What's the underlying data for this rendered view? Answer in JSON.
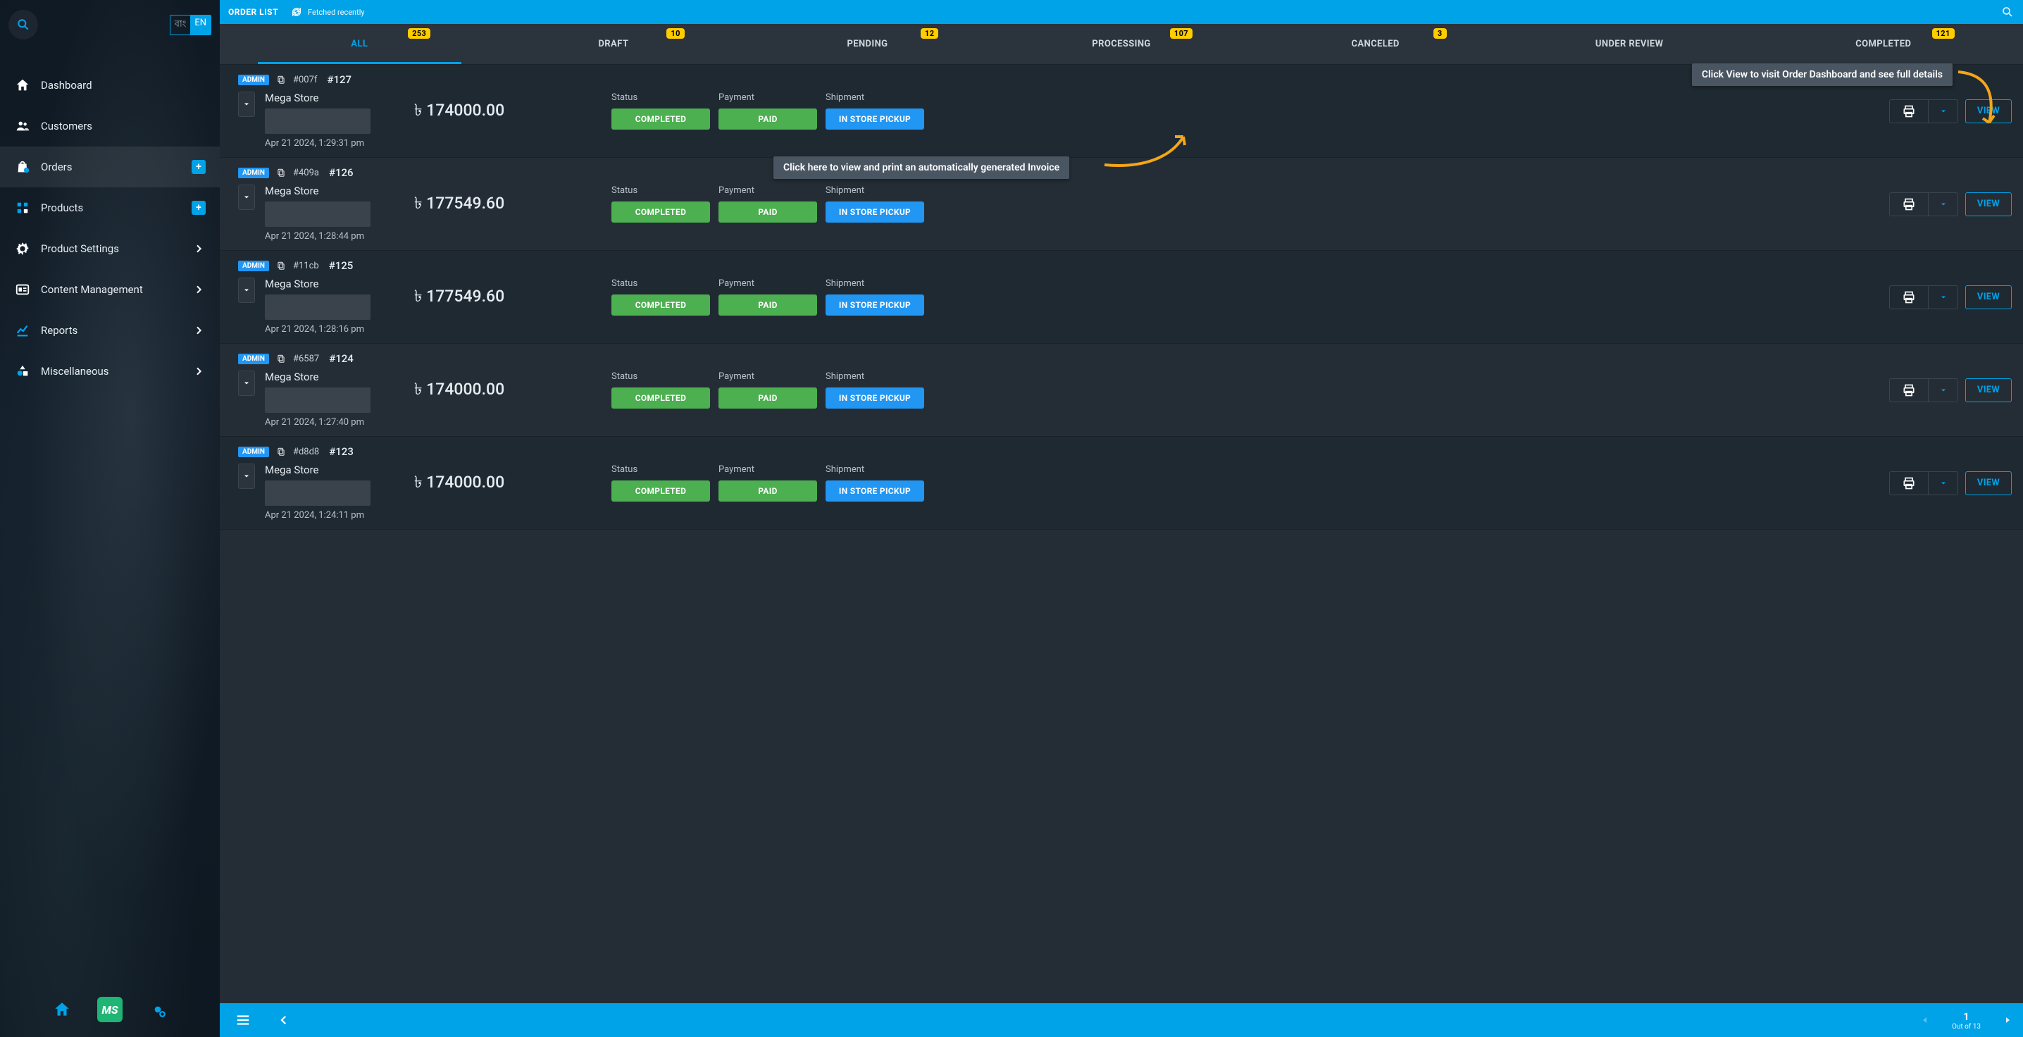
{
  "header": {
    "title": "ORDER LIST",
    "fetched": "Fetched recently"
  },
  "lang": {
    "inactive": "বাং",
    "active": "EN"
  },
  "sidebar": {
    "items": [
      {
        "label": "Dashboard"
      },
      {
        "label": "Customers"
      },
      {
        "label": "Orders"
      },
      {
        "label": "Products"
      },
      {
        "label": "Product Settings"
      },
      {
        "label": "Content Management"
      },
      {
        "label": "Reports"
      },
      {
        "label": "Miscellaneous"
      }
    ],
    "ms_badge": "MS"
  },
  "tabs": [
    {
      "label": "ALL",
      "badge": "253"
    },
    {
      "label": "DRAFT",
      "badge": "10"
    },
    {
      "label": "PENDING",
      "badge": "12"
    },
    {
      "label": "PROCESSING",
      "badge": "107"
    },
    {
      "label": "CANCELED",
      "badge": "3"
    },
    {
      "label": "UNDER REVIEW",
      "badge": null
    },
    {
      "label": "COMPLETED",
      "badge": "121"
    }
  ],
  "annotations": {
    "view": "Click View to visit Order Dashboard and see full details",
    "invoice": "Click here to view and print an automatically generated Invoice"
  },
  "labels": {
    "status": "Status",
    "payment": "Payment",
    "shipment": "Shipment",
    "view_btn": "VIEW",
    "admin": "ADMIN"
  },
  "orders": [
    {
      "hash": "#007f",
      "num": "#127",
      "store": "Mega Store",
      "ts": "Apr 21 2024, 1:29:31 pm",
      "amount": "৳ 174000.00",
      "status": "COMPLETED",
      "payment": "PAID",
      "shipment": "IN STORE PICKUP"
    },
    {
      "hash": "#409a",
      "num": "#126",
      "store": "Mega Store",
      "ts": "Apr 21 2024, 1:28:44 pm",
      "amount": "৳ 177549.60",
      "status": "COMPLETED",
      "payment": "PAID",
      "shipment": "IN STORE PICKUP"
    },
    {
      "hash": "#11cb",
      "num": "#125",
      "store": "Mega Store",
      "ts": "Apr 21 2024, 1:28:16 pm",
      "amount": "৳ 177549.60",
      "status": "COMPLETED",
      "payment": "PAID",
      "shipment": "IN STORE PICKUP"
    },
    {
      "hash": "#6587",
      "num": "#124",
      "store": "Mega Store",
      "ts": "Apr 21 2024, 1:27:40 pm",
      "amount": "৳ 174000.00",
      "status": "COMPLETED",
      "payment": "PAID",
      "shipment": "IN STORE PICKUP"
    },
    {
      "hash": "#d8d8",
      "num": "#123",
      "store": "Mega Store",
      "ts": "Apr 21 2024, 1:24:11 pm",
      "amount": "৳ 174000.00",
      "status": "COMPLETED",
      "payment": "PAID",
      "shipment": "IN STORE PICKUP"
    }
  ],
  "pagination": {
    "current": "1",
    "total_label": "Out of 13"
  }
}
